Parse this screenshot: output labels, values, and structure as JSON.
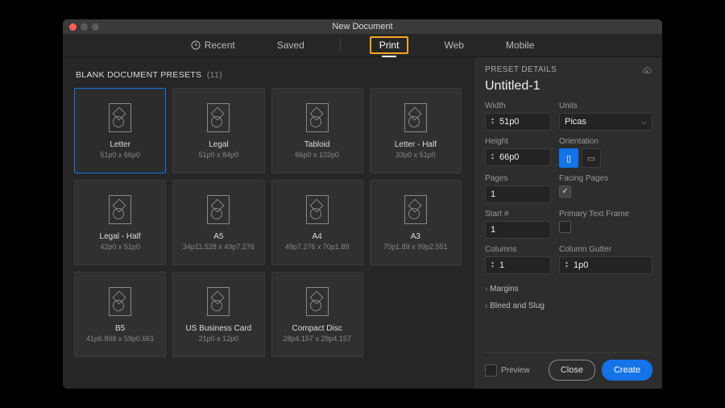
{
  "window_title": "New Document",
  "tabs": {
    "recent": "Recent",
    "saved": "Saved",
    "print": "Print",
    "web": "Web",
    "mobile": "Mobile"
  },
  "section": {
    "label": "BLANK DOCUMENT PRESETS",
    "count": "(11)"
  },
  "presets": [
    {
      "name": "Letter",
      "dim": "51p0 x 66p0"
    },
    {
      "name": "Legal",
      "dim": "51p0 x 84p0"
    },
    {
      "name": "Tabloid",
      "dim": "66p0 x 102p0"
    },
    {
      "name": "Letter - Half",
      "dim": "33p0 x 51p0"
    },
    {
      "name": "Legal - Half",
      "dim": "42p0 x 51p0"
    },
    {
      "name": "A5",
      "dim": "34p11.528 x 49p7.276"
    },
    {
      "name": "A4",
      "dim": "49p7.276 x 70p1.89"
    },
    {
      "name": "A3",
      "dim": "70p1.89 x 99p2.551"
    },
    {
      "name": "B5",
      "dim": "41p6.898 x 59p0.661"
    },
    {
      "name": "US Business Card",
      "dim": "21p0 x 12p0"
    },
    {
      "name": "Compact Disc",
      "dim": "28p4.157 x 28p4.157"
    }
  ],
  "details": {
    "header": "PRESET DETAILS",
    "title": "Untitled-1",
    "width_label": "Width",
    "width_value": "51p0",
    "units_label": "Units",
    "units_value": "Picas",
    "height_label": "Height",
    "height_value": "66p0",
    "orientation_label": "Orientation",
    "pages_label": "Pages",
    "pages_value": "1",
    "facing_label": "Facing Pages",
    "start_label": "Start #",
    "start_value": "1",
    "primary_label": "Primary Text Frame",
    "columns_label": "Columns",
    "columns_value": "1",
    "gutter_label": "Column Gutter",
    "gutter_value": "1p0",
    "margins": "Margins",
    "bleed": "Bleed and Slug",
    "preview": "Preview",
    "close": "Close",
    "create": "Create"
  }
}
